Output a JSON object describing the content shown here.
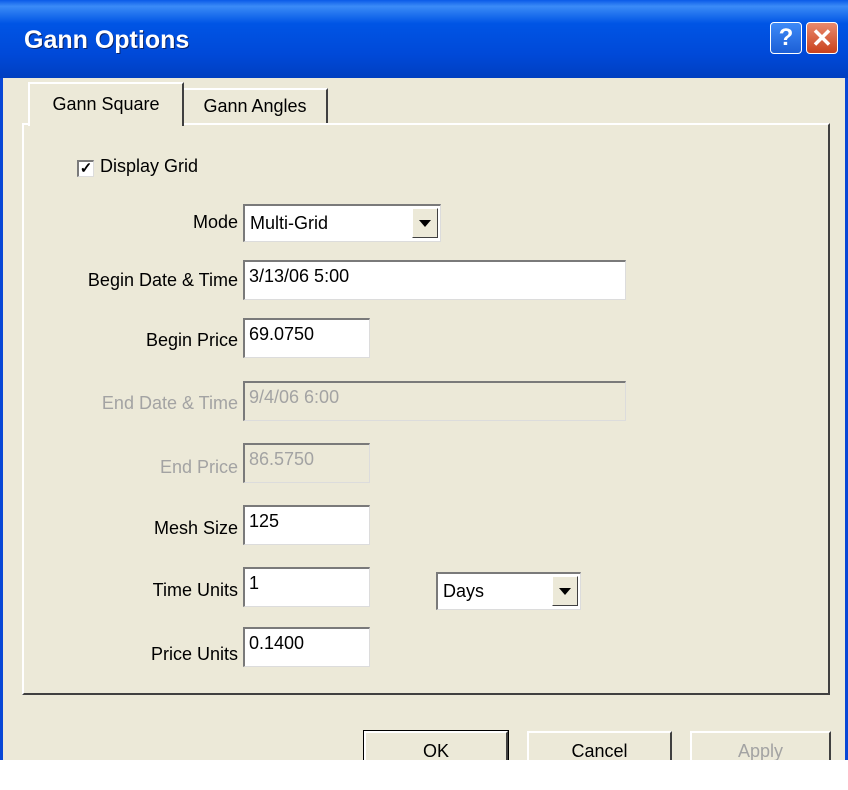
{
  "window": {
    "title": "Gann Options"
  },
  "titlebar": {
    "help_glyph": "?",
    "close_glyph": "✕",
    "help_icon": "help-icon",
    "close_icon": "close-icon"
  },
  "tabs": [
    {
      "label": "Gann Square",
      "active": true
    },
    {
      "label": "Gann Angles",
      "active": false
    }
  ],
  "form": {
    "display_grid": {
      "label": "Display Grid",
      "checked": true,
      "check_glyph": "✓"
    },
    "mode": {
      "label": "Mode",
      "value": "Multi-Grid"
    },
    "begin_date": {
      "label": "Begin Date & Time",
      "value": "3/13/06 5:00"
    },
    "begin_price": {
      "label": "Begin Price",
      "value": "69.0750"
    },
    "end_date": {
      "label": "End Date & Time",
      "value": "9/4/06 6:00",
      "disabled": true
    },
    "end_price": {
      "label": "End Price",
      "value": "86.5750",
      "disabled": true
    },
    "mesh_size": {
      "label": "Mesh Size",
      "value": "125"
    },
    "time_units": {
      "label": "Time Units",
      "value": "1",
      "unit": "Days"
    },
    "price_units": {
      "label": "Price Units",
      "value": "0.1400"
    }
  },
  "buttons": {
    "ok": "OK",
    "cancel": "Cancel",
    "apply": "Apply"
  },
  "colors": {
    "titlebar": "#0055e5",
    "face": "#ece9d8",
    "disabled_text": "#a3a3a3",
    "close": "#c9411c"
  }
}
